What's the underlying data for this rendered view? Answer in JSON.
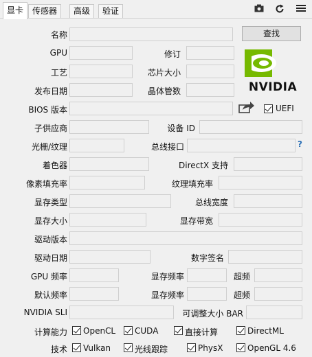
{
  "tabs": [
    "显卡",
    "传感器",
    "高级",
    "验证"
  ],
  "toolbar": {
    "camera_icon": "camera-icon",
    "refresh_icon": "refresh-icon",
    "menu_icon": "menu-icon"
  },
  "fields": {
    "name": "名称",
    "lookup": "查找",
    "gpu": "GPU",
    "revision": "修订",
    "process": "工艺",
    "die_size": "芯片大小",
    "release_date": "发布日期",
    "transistors": "晶体管数",
    "bios": "BIOS 版本",
    "uefi": "UEFI",
    "subvendor": "子供应商",
    "device_id": "设备 ID",
    "rops_tmus": "光栅/纹理",
    "bus_interface": "总线接口",
    "shaders": "着色器",
    "directx": "DirectX 支持",
    "pixel_fill": "像素填充率",
    "texture_fill": "纹理填充率",
    "mem_type": "显存类型",
    "bus_width": "总线宽度",
    "mem_size": "显存大小",
    "bandwidth": "显存带宽",
    "driver_version": "驱动版本",
    "driver_date": "驱动日期",
    "digital_sig": "数字签名",
    "gpu_clock": "GPU 频率",
    "memory1": "显存频率",
    "boost1": "超频",
    "default_clock": "默认频率",
    "memory2": "显存频率",
    "boost2": "超频",
    "sli": "NVIDIA SLI",
    "rebar": "可调整大小 BAR",
    "compute": "计算能力",
    "tech": "技术"
  },
  "brand": {
    "logo_text": "NVIDIA",
    "color": "#76b900"
  },
  "compute_items": [
    "OpenCL",
    "CUDA",
    "直接计算",
    "DirectML"
  ],
  "tech_items": [
    "Vulkan",
    "光线跟踪",
    "PhysX",
    "OpenGL 4.6"
  ],
  "help_mark": "?"
}
